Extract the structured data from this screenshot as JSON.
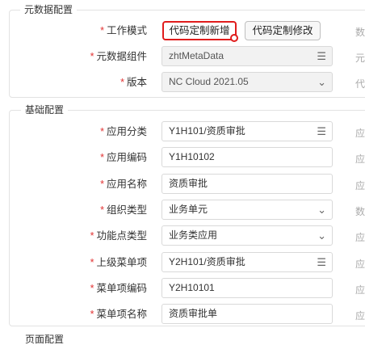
{
  "meta_section": {
    "title": "元数据配置",
    "work_mode": {
      "label": "工作模式",
      "options": [
        "代码定制新增",
        "代码定制修改"
      ],
      "selected": "代码定制新增",
      "ghost": "数"
    },
    "meta_component": {
      "label": "元数据组件",
      "value": "zhtMetaData",
      "icon": "list-icon",
      "ghost": "元"
    },
    "version": {
      "label": "版本",
      "value": "NC Cloud 2021.05",
      "icon": "chevron-down-icon",
      "ghost": "代"
    }
  },
  "basic_section": {
    "title": "基础配置",
    "fields": [
      {
        "label": "应用分类",
        "value": "Y1H101/资质审批",
        "icon": "list-icon",
        "ghost": "应"
      },
      {
        "label": "应用编码",
        "value": "Y1H10102",
        "icon": "",
        "ghost": "应"
      },
      {
        "label": "应用名称",
        "value": "资质审批",
        "icon": "",
        "ghost": "应"
      },
      {
        "label": "组织类型",
        "value": "业务单元",
        "icon": "chevron-down-icon",
        "ghost": "数"
      },
      {
        "label": "功能点类型",
        "value": "业务类应用",
        "icon": "chevron-down-icon",
        "ghost": "应"
      },
      {
        "label": "上级菜单项",
        "value": "Y2H101/资质审批",
        "icon": "list-icon",
        "ghost": "应"
      },
      {
        "label": "菜单项编码",
        "value": "Y2H10101",
        "icon": "",
        "ghost": "应"
      },
      {
        "label": "菜单项名称",
        "value": "资质审批单",
        "icon": "",
        "ghost": "应"
      }
    ]
  },
  "page_section": {
    "title": "页面配置"
  },
  "required_mark": "*"
}
